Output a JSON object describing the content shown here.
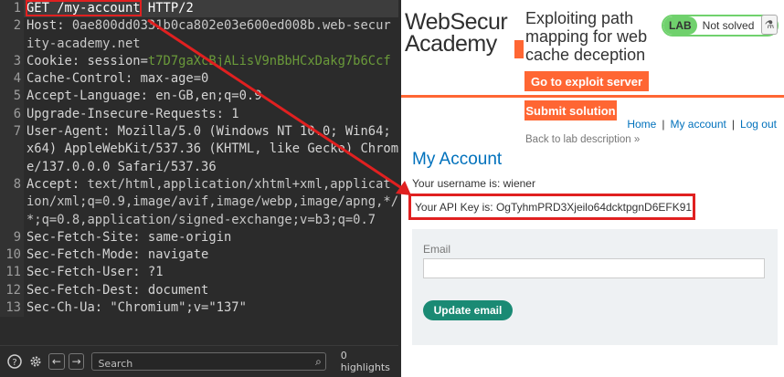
{
  "request": {
    "lines": [
      {
        "n": "1",
        "parts": [
          {
            "t": "GET /my-account",
            "c": "hl"
          },
          {
            "t": " HTTP/2",
            "c": ""
          }
        ]
      },
      {
        "n": "2",
        "parts": [
          {
            "t": "Host:",
            "c": ""
          },
          {
            "t": " 0ae800dd0331b0ca802e03e600ed008b.web-security-academy.net",
            "c": "dim"
          }
        ]
      },
      {
        "n": "3",
        "parts": [
          {
            "t": "Cookie: session=",
            "c": ""
          },
          {
            "t": "t7D7gaXcBjALisV9nBbHCxDakg7b6Ccf",
            "c": "green"
          }
        ]
      },
      {
        "n": "4",
        "parts": [
          {
            "t": "Cache-Control: max-age=0",
            "c": ""
          }
        ]
      },
      {
        "n": "5",
        "parts": [
          {
            "t": "Accept-Language: en-GB,en;q=0.9",
            "c": ""
          }
        ]
      },
      {
        "n": "6",
        "parts": [
          {
            "t": "Upgrade-Insecure-Requests: 1",
            "c": ""
          }
        ]
      },
      {
        "n": "7",
        "parts": [
          {
            "t": "User-Agent: Mozilla/5.0 (Windows NT 10.0; Win64; x64) AppleWebKit/537.36 (KHTML, like Gecko) Chrome/137.0.0.0 Safari/537.36",
            "c": ""
          }
        ]
      },
      {
        "n": "8",
        "parts": [
          {
            "t": "Accept:",
            "c": ""
          },
          {
            "t": " text/html,application/xhtml+xml,application/xml;q=0.9,image/avif,image/webp,image/apng,*/*;q=0.8,application/signed-exchange;v=b3;q=0.7",
            "c": "dim"
          }
        ]
      },
      {
        "n": "9",
        "parts": [
          {
            "t": "Sec-Fetch-Site: same-origin",
            "c": ""
          }
        ]
      },
      {
        "n": "10",
        "parts": [
          {
            "t": "Sec-Fetch-Mode: navigate",
            "c": ""
          }
        ]
      },
      {
        "n": "11",
        "parts": [
          {
            "t": "Sec-Fetch-User: ?1",
            "c": ""
          }
        ]
      },
      {
        "n": "12",
        "parts": [
          {
            "t": "Sec-Fetch-Dest: document",
            "c": ""
          }
        ]
      },
      {
        "n": "13",
        "parts": [
          {
            "t": "Sec-Ch-Ua: \"Chromium\";v=\"137\"",
            "c": ""
          }
        ]
      }
    ]
  },
  "toolbar": {
    "help_icon": "question-circle-icon",
    "settings_icon": "gear-icon",
    "back_icon": "arrow-left-icon",
    "forward_icon": "arrow-right-icon",
    "search_placeholder": "Search",
    "highlights": "0 highlights"
  },
  "page": {
    "logo_line1": "WebSecur",
    "logo_line2": "Academy",
    "lab_title": "Exploiting path mapping for web cache deception",
    "lab_tag": "LAB",
    "lab_status": "Not solved",
    "exploit_button": "Go to exploit server",
    "submit_button": "Submit solution",
    "back_link": "Back to lab description",
    "back_chevron": "»",
    "nav": {
      "home": "Home",
      "sep": "|",
      "account": "My account",
      "logout": "Log out"
    },
    "title": "My Account",
    "username_text": "Your username is: wiener",
    "api_key_text": "Your API Key is: OgTyhmPRD3Xjeilo64dcktpgnD6EFK91",
    "email_label": "Email",
    "email_value": "",
    "update_button": "Update email"
  },
  "colors": {
    "accent": "#ff6633",
    "link": "#0071bc",
    "annotation": "#e02020",
    "lab_green": "#70d16d",
    "update_green": "#1a8a74"
  }
}
